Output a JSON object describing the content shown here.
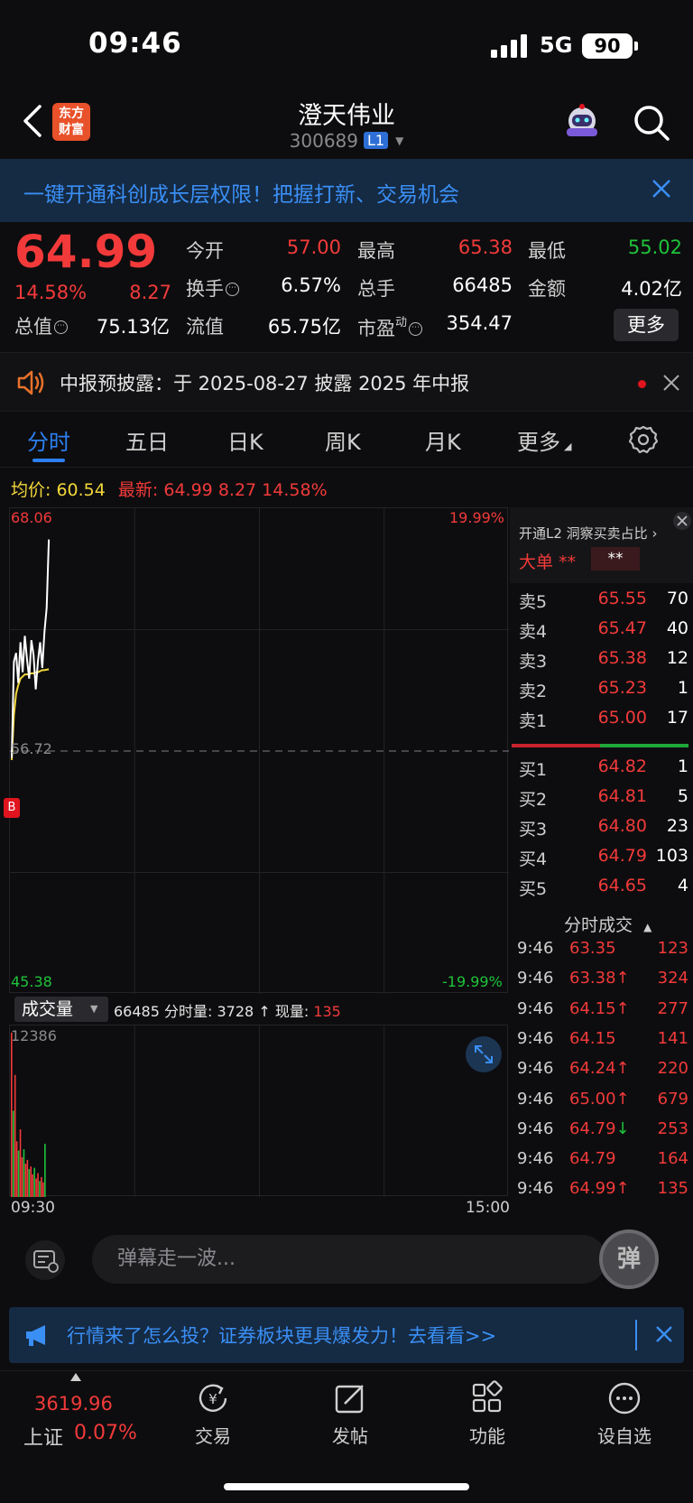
{
  "status": {
    "time": "09:46",
    "network": "5G",
    "battery": "90"
  },
  "nav": {
    "logo_line1": "东方",
    "logo_line2": "财富",
    "stock_name": "澄天伟业",
    "stock_code": "300689",
    "level_badge": "L1"
  },
  "banner": {
    "text": "一键开通科创成长层权限！把握打新、交易机会"
  },
  "quote": {
    "price": "64.99",
    "change_pct": "14.58%",
    "change": "8.27",
    "open_label": "今开",
    "open": "57.00",
    "high_label": "最高",
    "high": "65.38",
    "low_label": "最低",
    "low": "55.02",
    "turnover_label": "换手",
    "turnover": "6.57%",
    "volume_label": "总手",
    "volume": "66485",
    "amount_label": "金额",
    "amount": "4.02亿",
    "mktcap_label": "总值",
    "mktcap": "75.13亿",
    "float_label": "流值",
    "float_cap": "65.75亿",
    "pe_label": "市盈",
    "pe_sup": "动",
    "pe": "354.47",
    "more": "更多"
  },
  "notice": {
    "text": "中报预披露：于 2025-08-27 披露 2025 年中报"
  },
  "tabs": [
    "分时",
    "五日",
    "日K",
    "周K",
    "月K",
    "更多"
  ],
  "avg": {
    "avg_label": "均价:",
    "avg": "60.54",
    "latest_label": "最新:",
    "latest": "64.99",
    "change": "8.27",
    "pct": "14.58%"
  },
  "chart_data": {
    "type": "line",
    "title": "",
    "y_top": "68.06",
    "y_top_pct": "19.99%",
    "y_mid": "56.72",
    "y_bottom": "45.38",
    "y_bottom_pct": "-19.99%",
    "ylim": [
      45.38,
      68.06
    ],
    "prev_close": 56.72,
    "x_start": "09:30",
    "x_end": "15:00",
    "series": [
      {
        "values": [
          56.4,
          60.9,
          61.3,
          59.9,
          61.8,
          60.4,
          62.1,
          61.0,
          60.1,
          61.9,
          61.2,
          59.6,
          60.9,
          61.8,
          60.6,
          62.3,
          63.4,
          66.6
        ]
      },
      {
        "values": [
          56.3,
          58.4,
          59.4,
          59.8,
          60.1,
          60.2,
          60.3,
          60.3,
          60.3,
          60.35,
          60.35,
          60.4,
          60.4,
          60.45,
          60.5,
          60.5,
          60.52,
          60.54
        ]
      }
    ]
  },
  "volume": {
    "selector": "成交量",
    "total": "66485",
    "period_label": "分时量:",
    "period_value": "3728",
    "current_label": "现量:",
    "current_value": "135",
    "max": "12386",
    "bars": [
      12386,
      6500,
      9200,
      4200,
      3500,
      5100,
      3000,
      3600,
      2500,
      2800,
      2100,
      2300,
      1700,
      2200,
      1400,
      1800,
      1200,
      1500,
      1100,
      4000
    ]
  },
  "l2": {
    "promo": "开通L2 洞察买卖占比",
    "big_order_label": "大单",
    "big_order_mask1": "**",
    "big_order_mask2": "**"
  },
  "orderbook": {
    "asks": [
      {
        "label": "卖5",
        "price": "65.55",
        "vol": "70"
      },
      {
        "label": "卖4",
        "price": "65.47",
        "vol": "40"
      },
      {
        "label": "卖3",
        "price": "65.38",
        "vol": "12"
      },
      {
        "label": "卖2",
        "price": "65.23",
        "vol": "1"
      },
      {
        "label": "卖1",
        "price": "65.00",
        "vol": "17"
      }
    ],
    "bids": [
      {
        "label": "买1",
        "price": "64.82",
        "vol": "1"
      },
      {
        "label": "买2",
        "price": "64.81",
        "vol": "5"
      },
      {
        "label": "买3",
        "price": "64.80",
        "vol": "23"
      },
      {
        "label": "买4",
        "price": "64.79",
        "vol": "103"
      },
      {
        "label": "买5",
        "price": "64.65",
        "vol": "4"
      }
    ]
  },
  "trades": {
    "header": "分时成交",
    "rows": [
      {
        "time": "9:46",
        "price": "63.35",
        "arrow": "",
        "vol": "123",
        "dir": "up"
      },
      {
        "time": "9:46",
        "price": "63.38",
        "arrow": "↑",
        "vol": "324",
        "dir": "up"
      },
      {
        "time": "9:46",
        "price": "64.15",
        "arrow": "↑",
        "vol": "277",
        "dir": "up"
      },
      {
        "time": "9:46",
        "price": "64.15",
        "arrow": "",
        "vol": "141",
        "dir": "up"
      },
      {
        "time": "9:46",
        "price": "64.24",
        "arrow": "↑",
        "vol": "220",
        "dir": "up"
      },
      {
        "time": "9:46",
        "price": "65.00",
        "arrow": "↑",
        "vol": "679",
        "dir": "up"
      },
      {
        "time": "9:46",
        "price": "64.79",
        "arrow": "↓",
        "vol": "253",
        "dir": "down"
      },
      {
        "time": "9:46",
        "price": "64.79",
        "arrow": "",
        "vol": "164",
        "dir": "up"
      },
      {
        "time": "9:46",
        "price": "64.99",
        "arrow": "↑",
        "vol": "135",
        "dir": "up"
      }
    ]
  },
  "danmu": {
    "placeholder": "弹幕走一波...",
    "button": "弹"
  },
  "promo": {
    "text": "行情来了怎么投？证券板块更具爆发力！去看看>>"
  },
  "bottom_nav": {
    "index_value": "3619.96",
    "index_name": "上证",
    "index_pct": "0.07%",
    "items": [
      "交易",
      "发帖",
      "功能",
      "设自选"
    ],
    "trade_icon_glyph": "¥"
  },
  "colors": {
    "up": "#f23a3a",
    "down": "#1fc33a",
    "accent": "#2d7ff0",
    "price_line": "#ffffff",
    "avg_line": "#f2d73a"
  }
}
